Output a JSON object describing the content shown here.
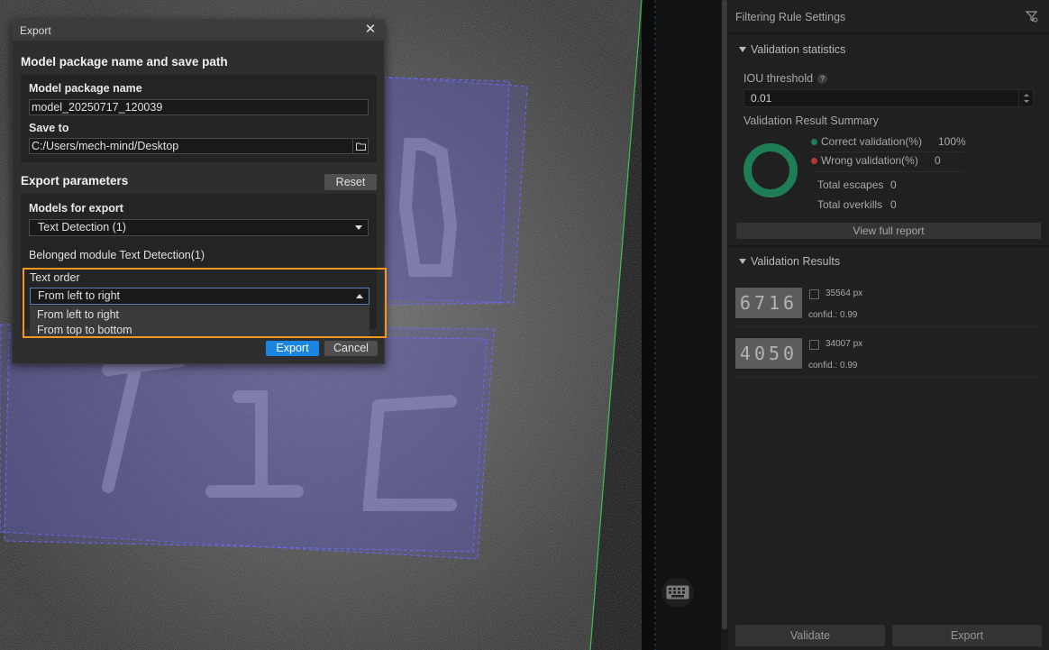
{
  "dialog": {
    "title": "Export",
    "section_path": "Model package name and save path",
    "package_name_label": "Model package name",
    "package_name_value": "model_20250717_120039",
    "save_to_label": "Save to",
    "save_to_value": "C:/Users/mech-mind/Desktop",
    "section_params": "Export parameters",
    "reset_label": "Reset",
    "models_label": "Models for export",
    "models_value": "Text Detection (1)",
    "belonged_module": "Belonged module Text Detection(1)",
    "text_order_label": "Text order",
    "text_order_value": "From left to right",
    "text_order_options": [
      "From left to right",
      "From top to bottom"
    ],
    "export_label": "Export",
    "cancel_label": "Cancel"
  },
  "right_panel": {
    "header": "Filtering Rule Settings",
    "validation_statistics": {
      "title": "Validation statistics",
      "iou_label": "IOU threshold",
      "iou_value": "0.01",
      "summary_label": "Validation Result Summary",
      "correct_label": "Correct validation(%)",
      "correct_value": "100%",
      "wrong_label": "Wrong validation(%)",
      "wrong_value": "0",
      "escapes_label": "Total escapes",
      "escapes_value": "0",
      "overkills_label": "Total overkills",
      "overkills_value": "0",
      "correct_fraction": 1.0,
      "view_report_label": "View full report"
    },
    "validation_results": {
      "title": "Validation Results",
      "items": [
        {
          "area": "35564 px",
          "confidence": "confid.: 0.99",
          "thumb_text": "6716"
        },
        {
          "area": "34007 px",
          "confidence": "confid.: 0.99",
          "thumb_text": "4050"
        }
      ]
    },
    "validate_label": "Validate",
    "export_label": "Export"
  },
  "colors": {
    "accent": "#1a85e0",
    "highlight": "#f5961e",
    "correct": "#1f7d55",
    "wrong": "#b3382e"
  }
}
